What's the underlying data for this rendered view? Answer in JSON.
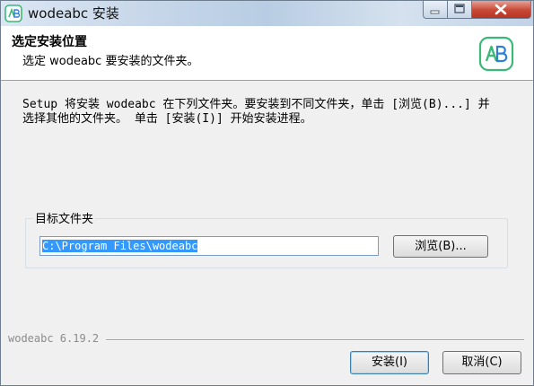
{
  "window": {
    "title": "wodeabc 安装"
  },
  "header": {
    "title": "选定安装位置",
    "subtitle": "选定 wodeabc 要安装的文件夹。",
    "logo_text": "AB"
  },
  "body": {
    "desc_line1": "Setup 将安装 wodeabc 在下列文件夹。要安装到不同文件夹，单击 [浏览(B)...] 并",
    "desc_line2": "选择其他的文件夹。 单击 [安装(I)] 开始安装进程。"
  },
  "destination": {
    "group_label": "目标文件夹",
    "path": "C:\\Program Files\\wodeabc",
    "browse_label": "浏览(B)..."
  },
  "footer": {
    "version": "wodeabc 6.19.2",
    "install_label": "安装(I)",
    "cancel_label": "取消(C)"
  },
  "colors": {
    "accent_green": "#3cb878",
    "accent_blue": "#2f7fd6",
    "selection": "#3399ff",
    "close_red": "#c74835"
  }
}
